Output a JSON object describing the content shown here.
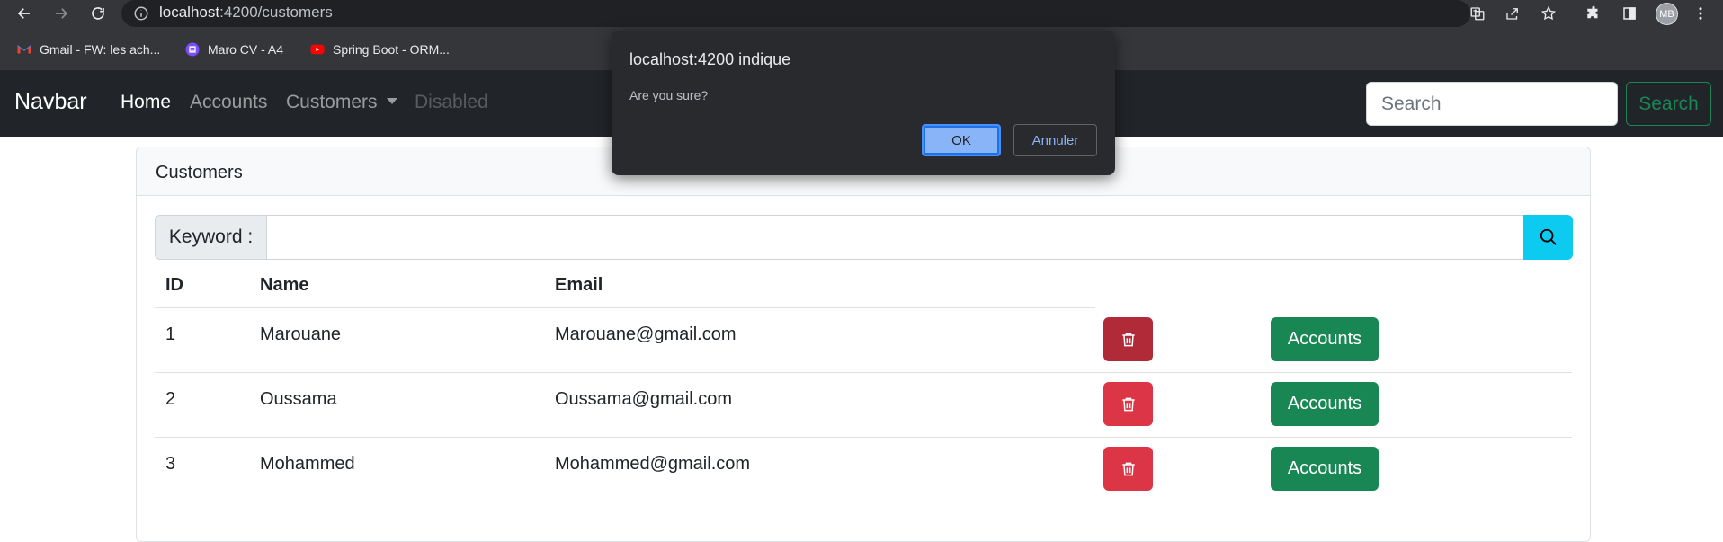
{
  "browser": {
    "url_host": "localhost",
    "url_rest": ":4200/customers",
    "profile_initials": "MB",
    "bookmarks": [
      {
        "label": "Gmail - FW: les ach...",
        "icon": "gmail-icon"
      },
      {
        "label": "Maro CV - A4",
        "icon": "document-icon"
      },
      {
        "label": "Spring Boot - ORM...",
        "icon": "youtube-icon"
      }
    ]
  },
  "navbar": {
    "brand": "Navbar",
    "links": {
      "home": "Home",
      "accounts": "Accounts",
      "customers": "Customers",
      "disabled": "Disabled"
    },
    "search_placeholder": "Search",
    "search_button": "Search"
  },
  "card": {
    "title": "Customers",
    "keyword_label": "Keyword :",
    "keyword_value": ""
  },
  "table": {
    "headers": {
      "id": "ID",
      "name": "Name",
      "email": "Email"
    },
    "rows": [
      {
        "id": "1",
        "name": "Marouane",
        "email": "Marouane@gmail.com",
        "accounts_label": "Accounts"
      },
      {
        "id": "2",
        "name": "Oussama",
        "email": "Oussama@gmail.com",
        "accounts_label": "Accounts"
      },
      {
        "id": "3",
        "name": "Mohammed",
        "email": "Mohammed@gmail.com",
        "accounts_label": "Accounts"
      }
    ]
  },
  "dialog": {
    "title": "localhost:4200 indique",
    "message": "Are you sure?",
    "ok_label": "OK",
    "cancel_label": "Annuler"
  },
  "colors": {
    "navbar_bg": "#212529",
    "danger": "#dc3545",
    "success": "#198754",
    "info": "#0dcaf0",
    "dialog_bg": "#292a2d"
  }
}
